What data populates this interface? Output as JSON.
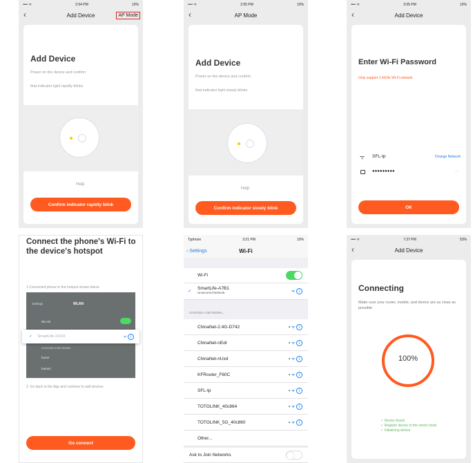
{
  "p1": {
    "time": "2:54 PM",
    "battery": "10%",
    "nav_title": "Add Device",
    "ap_mode": "AP Mode",
    "title": "Add Device",
    "desc1": "Power on the device and confirm",
    "desc2": "that indicator light rapidly blinks",
    "help": "Help",
    "button": "Confirm indicator rapidly blink"
  },
  "p2": {
    "time": "2:55 PM",
    "battery": "10%",
    "nav_title": "AP Mode",
    "title": "Add Device",
    "desc1": "Power on the device and confirm",
    "desc2": "that indicator light slowly blinks",
    "help": "Help",
    "button": "Confirm indicator slowly blink"
  },
  "p3": {
    "time": "3:05 PM",
    "battery": "10%",
    "nav_title": "Add Device",
    "title": "Enter Wi-Fi Password",
    "warning": "Only support 2.4GHz Wi-Fi network",
    "ssid": "SFL-tp",
    "change": "Change Network",
    "password": "●●●●●●●●●",
    "button": "OK"
  },
  "p4": {
    "title": "Connect the phone's Wi-Fi to the device's hotspot",
    "step1": "1.Connected phone to the hotspot shown below",
    "inner_settings": "Settings",
    "inner_title": "WLAN",
    "inner_wlan": "WLAN",
    "inner_smart": "SmartLife-XXXX",
    "inner_choose": "CHOOSE A NETWORK...",
    "inner_home": "home",
    "inner_home2": "home2",
    "step2": "2. Go back to the App and continue to add devices",
    "button": "Go connect"
  },
  "p5": {
    "carrier": "Typhoon",
    "time": "3:21 PM",
    "battery": "10%",
    "back": "Settings",
    "nav_title": "Wi-Fi",
    "wifi_label": "Wi-Fi",
    "connected": "SmartLife-A7B1",
    "connected_sub": "Unsecured Network",
    "choose": "CHOOSE A NETWORK...",
    "networks": [
      "ChinaNet-2.4G-D742",
      "ChinaNet-nEdr",
      "ChinaNet-nUxd",
      "KFRouter_F60C",
      "SFL-tp",
      "TOTOLINK_40c864",
      "TOTOLINK_5G_40c860",
      "Other..."
    ],
    "ask": "Ask to Join Networks"
  },
  "p6": {
    "time": "7:37 PM",
    "battery": "53%",
    "nav_title": "Add Device",
    "title": "Connecting",
    "desc": "Make sure your router, mobile, and device are as close as possible",
    "percent": "100%",
    "steps": [
      "✓ Device found",
      "✓ Register device to the smart cloud",
      "✓ Initializing device"
    ]
  },
  "colors": {
    "accent": "#ff5a1f",
    "ios_blue": "#1a7cf0",
    "ios_green": "#4cd964"
  }
}
